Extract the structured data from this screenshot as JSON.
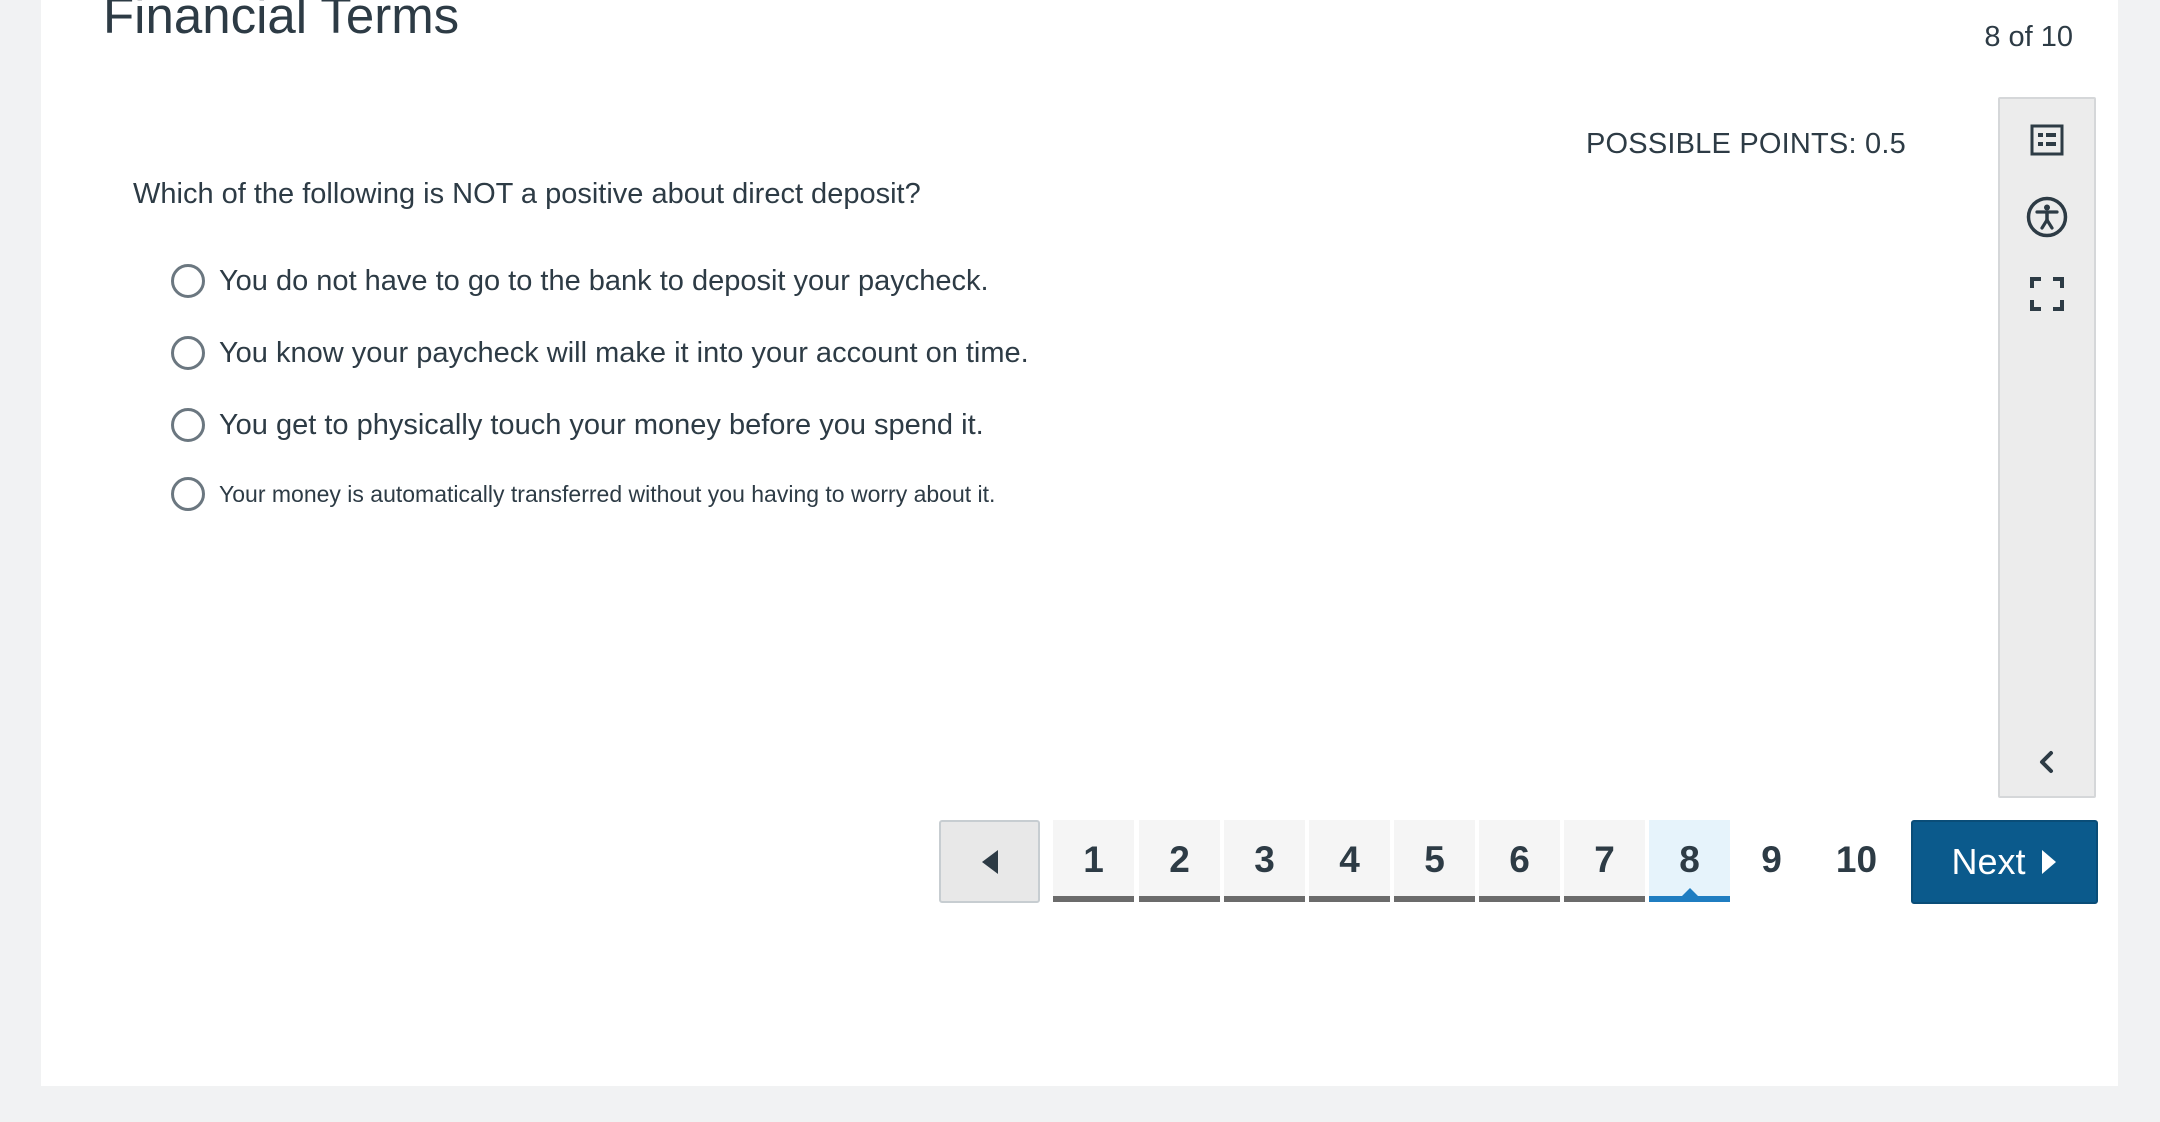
{
  "quiz": {
    "title": "Financial Terms",
    "progress": "8 of 10"
  },
  "question": {
    "points": "POSSIBLE POINTS: 0.5",
    "text": "Which of the following is NOT a positive about direct deposit?",
    "answers": [
      "You do not have to go to the bank to deposit your paycheck.",
      "You know your paycheck will make it into your account on time.",
      "You get to physically touch your money before you spend it.",
      "Your money is automatically transferred without you having to worry about it."
    ]
  },
  "toolbar": {
    "icons": [
      "question-list-icon",
      "accessibility-icon",
      "fullscreen-icon",
      "collapse-chevron-icon"
    ]
  },
  "pagination": {
    "pages": [
      "1",
      "2",
      "3",
      "4",
      "5",
      "6",
      "7",
      "8",
      "9",
      "10"
    ],
    "current_page": 8,
    "answered_pages": [
      1,
      2,
      3,
      4,
      5,
      6,
      7
    ],
    "next_label": "Next"
  },
  "colors": {
    "accent": "#1f7dc1",
    "next_button": "#0b5a8c",
    "text": "#2d3b45"
  }
}
